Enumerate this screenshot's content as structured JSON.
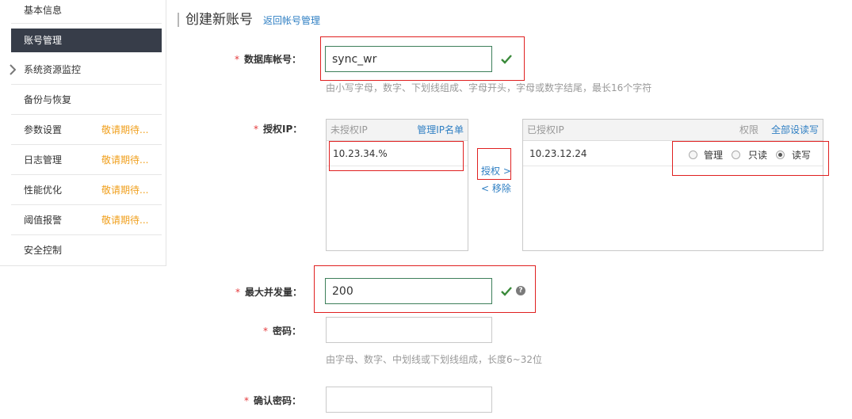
{
  "sidebar": {
    "items": [
      {
        "label": "基本信息",
        "soon": ""
      },
      {
        "label": "账号管理",
        "soon": ""
      },
      {
        "label": "系统资源监控",
        "soon": ""
      },
      {
        "label": "备份与恢复",
        "soon": ""
      },
      {
        "label": "参数设置",
        "soon": "敬请期待..."
      },
      {
        "label": "日志管理",
        "soon": "敬请期待..."
      },
      {
        "label": "性能优化",
        "soon": "敬请期待..."
      },
      {
        "label": "阈值报警",
        "soon": "敬请期待..."
      },
      {
        "label": "安全控制",
        "soon": ""
      }
    ],
    "active_index": 1
  },
  "header": {
    "title": "创建新账号",
    "back_link": "返回帐号管理"
  },
  "form": {
    "required_mark": "*",
    "account": {
      "label": "数据库帐号：",
      "value": "sync_wr",
      "hint": "由小写字母，数字、下划线组成、字母开头，字母或数字结尾，最长16个字符"
    },
    "auth_ip": {
      "label": "授权IP：",
      "unauthorized": {
        "title": "未授权IP",
        "link": "管理IP名单",
        "items": [
          "10.23.34.%"
        ]
      },
      "authorize_btn": "授权 >",
      "remove_btn": "< 移除",
      "authorized": {
        "title": "已授权IP",
        "perm_label": "权限",
        "set_all_link": "全部设读写",
        "items": [
          {
            "ip": "10.23.12.24",
            "options": [
              "管理",
              "只读",
              "读写"
            ],
            "selected": "读写"
          }
        ]
      }
    },
    "max_conn": {
      "label": "最大并发量：",
      "value": "200",
      "help_icon_text": "?"
    },
    "password": {
      "label": "密码：",
      "value": "",
      "hint": "由字母、数字、中划线或下划线组成，长度6~32位"
    },
    "confirm_password": {
      "label": "确认密码：",
      "value": ""
    }
  },
  "colors": {
    "accent_link": "#2f7fc3",
    "required": "#e4393c",
    "soon": "#f0a01e",
    "active_bg": "#373d49",
    "valid_check": "#3a8a3a",
    "annotation_red": "#e02020"
  }
}
